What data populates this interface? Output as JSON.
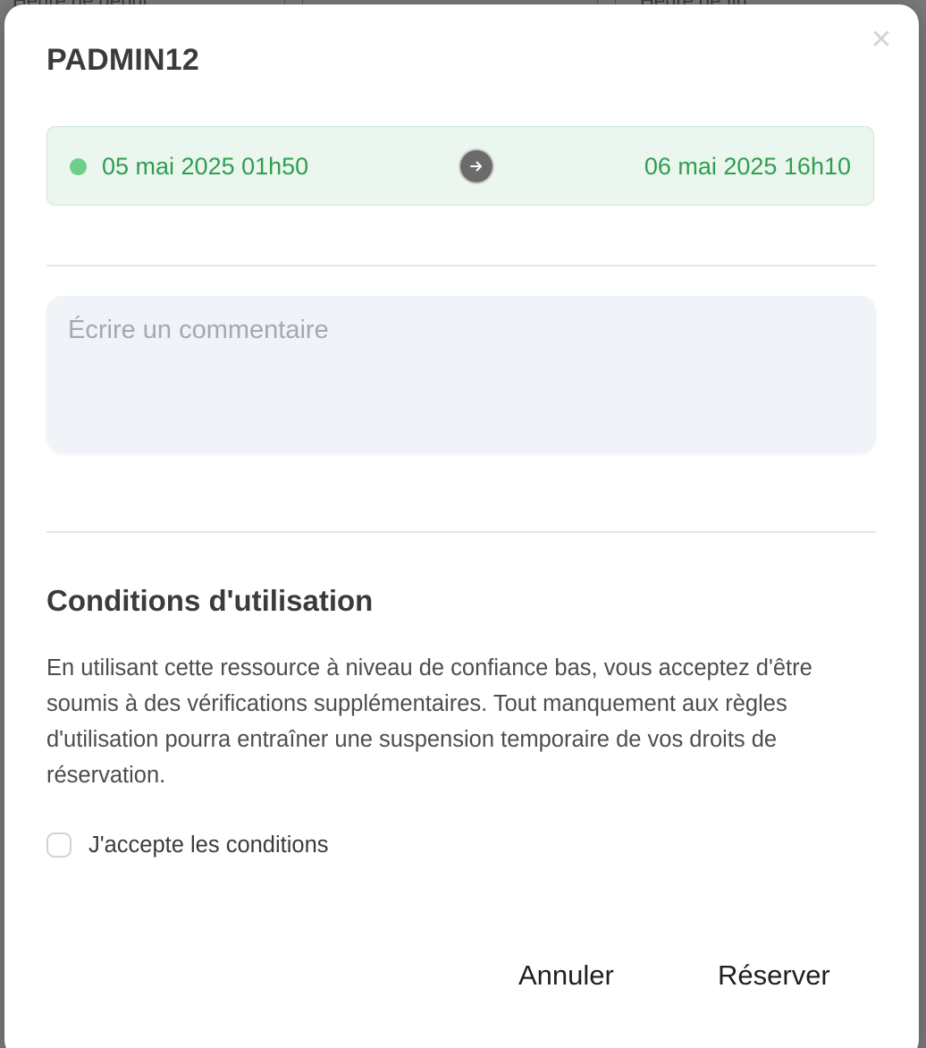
{
  "background": {
    "start_label": "Heure de début",
    "end_label": "Heure de fin"
  },
  "modal": {
    "title": "PADMIN12",
    "close_icon": "close-icon",
    "date_range": {
      "start": "05 mai 2025 01h50",
      "end": "06 mai 2025 16h10",
      "status_color": "#6fce8b",
      "text_color": "#2f9e50",
      "arrow_icon": "arrow-right-icon"
    },
    "comment": {
      "placeholder": "Écrire un commentaire",
      "value": ""
    },
    "conditions": {
      "title": "Conditions d'utilisation",
      "text": "En utilisant cette ressource à niveau de confiance bas, vous acceptez d'être soumis à des vérifications supplémentaires. Tout manquement aux règles d'utilisation pourra entraîner une suspension temporaire de vos droits de réservation.",
      "accept_label": "J'accepte les conditions",
      "accepted": false
    },
    "actions": {
      "cancel_label": "Annuler",
      "reserve_label": "Réserver"
    }
  }
}
